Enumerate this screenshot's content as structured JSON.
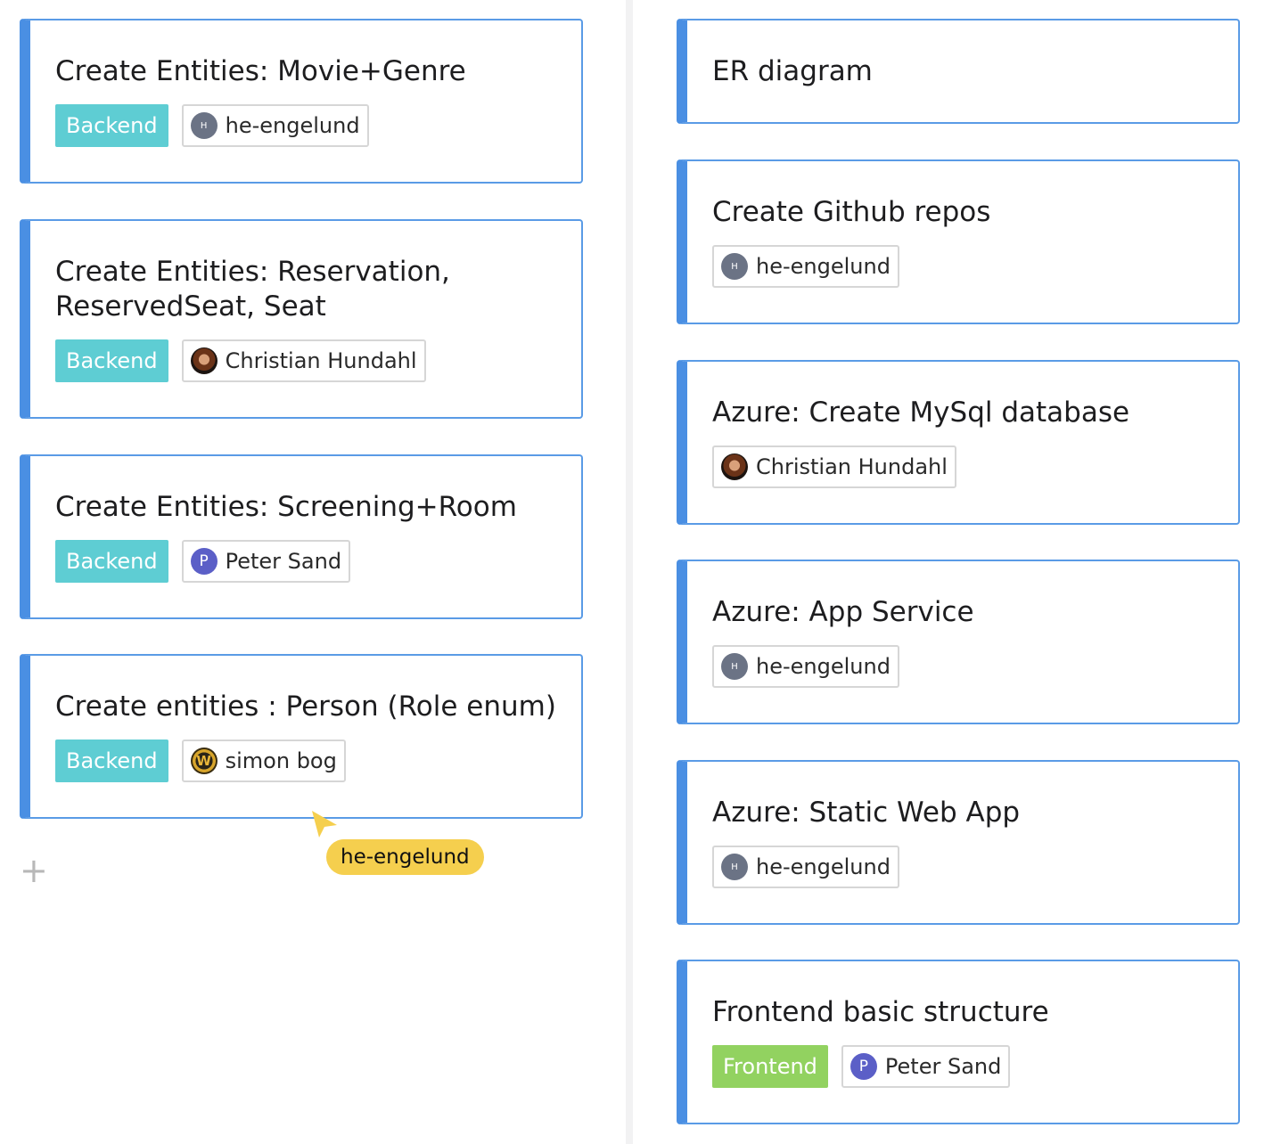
{
  "colors": {
    "card_border": "#5a9be6",
    "card_accent": "#4a8fe3",
    "label_backend": "#5ecdd3",
    "label_frontend": "#92d260",
    "cursor": "#f5cf4e"
  },
  "left_column": {
    "cards": [
      {
        "title": "Create Entities: Movie+Genre",
        "label": "Backend",
        "assignee": {
          "name": "he-engelund",
          "initial": "H",
          "avatar": "initial-gray"
        }
      },
      {
        "title": "Create Entities: Reservation, ReservedSeat, Seat",
        "label": "Backend",
        "assignee": {
          "name": "Christian Hundahl",
          "initial": "",
          "avatar": "photo"
        }
      },
      {
        "title": "Create Entities: Screening+Room",
        "label": "Backend",
        "assignee": {
          "name": "Peter Sand",
          "initial": "P",
          "avatar": "initial-purple"
        }
      },
      {
        "title": "Create entities : Person (Role enum)",
        "label": "Backend",
        "assignee": {
          "name": "simon bog",
          "initial": "W",
          "avatar": "wow-logo"
        }
      }
    ],
    "add_icon": "plus-icon"
  },
  "right_column": {
    "cards": [
      {
        "title": "ER diagram"
      },
      {
        "title": "Create Github repos",
        "assignee": {
          "name": "he-engelund",
          "initial": "H",
          "avatar": "initial-gray"
        }
      },
      {
        "title": "Azure: Create MySql database",
        "assignee": {
          "name": "Christian Hundahl",
          "initial": "",
          "avatar": "photo"
        }
      },
      {
        "title": "Azure: App Service",
        "assignee": {
          "name": "he-engelund",
          "initial": "H",
          "avatar": "initial-gray"
        }
      },
      {
        "title": "Azure: Static Web App",
        "assignee": {
          "name": "he-engelund",
          "initial": "H",
          "avatar": "initial-gray"
        }
      },
      {
        "title": "Frontend basic structure",
        "label": "Frontend",
        "assignee": {
          "name": "Peter Sand",
          "initial": "P",
          "avatar": "initial-purple"
        }
      }
    ]
  },
  "collaborator_cursor": {
    "name": "he-engelund",
    "icon": "cursor-pointer-icon"
  }
}
